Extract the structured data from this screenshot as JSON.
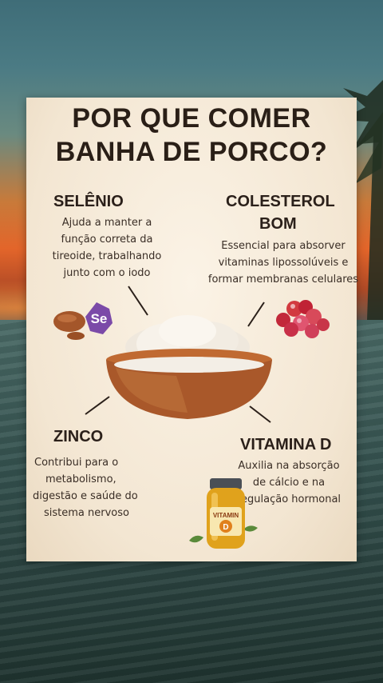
{
  "title_line1": "POR QUE COMER",
  "title_line2": "BANHA DE PORCO?",
  "selenio": {
    "heading": "SELÊNIO",
    "lines": [
      "Ajuda a manter a",
      "função correta da",
      "tireoide, trabalhando",
      "junto com o iodo"
    ],
    "icon_text": "Se"
  },
  "colesterol": {
    "heading_line1": "COLESTEROL",
    "heading_line2": "BOM",
    "lines": [
      "Essencial para absorver",
      "vitaminas lipossolúveis e",
      "formar membranas celulares"
    ]
  },
  "zinco": {
    "heading": "ZINCO",
    "lines": [
      "Contribui para o",
      "metabolismo,",
      "digestão e saúde do",
      "sistema nervoso"
    ]
  },
  "vitamina": {
    "heading": "VITAMINA D",
    "lines": [
      "Auxilia na absorção",
      "de cálcio e na",
      "regulação hormonal"
    ],
    "jar_label": "VITAMIN",
    "jar_letter": "D"
  },
  "colors": {
    "text": "#2b201a",
    "card": "#f5ead8",
    "bowl": "#a9582a",
    "lard": "#f2ede4",
    "selenium_badge": "#7b4aa8",
    "berries": "#c2283a",
    "jar": "#e0a21c"
  }
}
